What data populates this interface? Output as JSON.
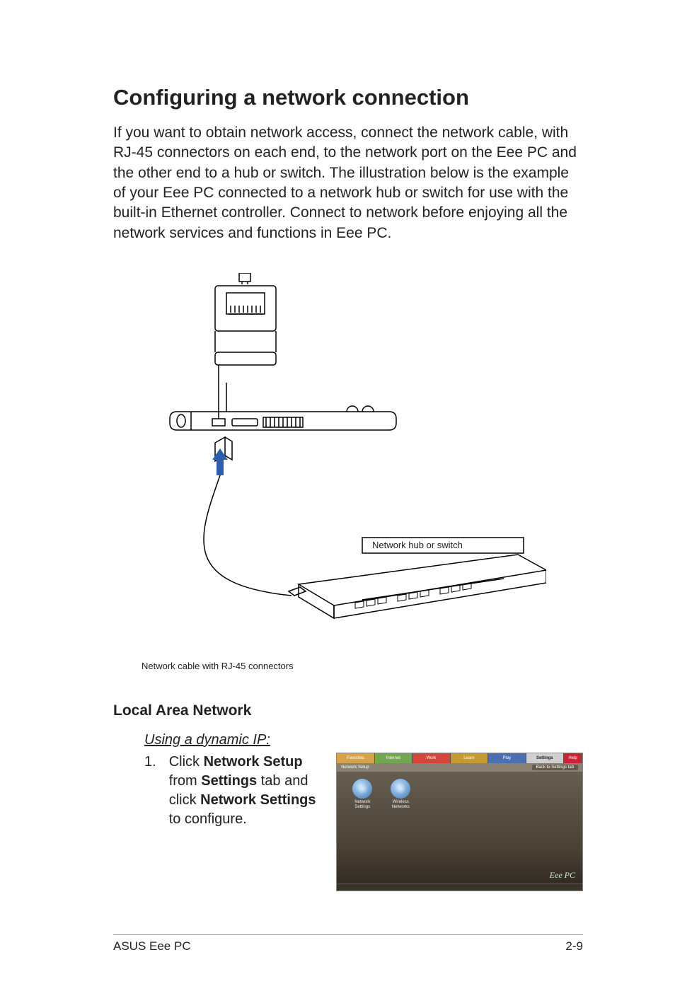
{
  "h1": "Configuring a network connection",
  "intro": "If you want to obtain network access, connect the network cable, with RJ-45 connectors on each end, to the network port on the Eee PC and the other end to a hub or switch. The illustration below is the example of your Eee PC connected to a network hub or switch for use with the built-in Ethernet controller. Connect to network before enjoying all the network services and functions in Eee PC.",
  "figure": {
    "hub_label": "Network hub or switch",
    "cable_label": "Network cable with RJ-45 connectors"
  },
  "h2": "Local Area Network",
  "h3": "Using a dynamic IP:",
  "step1": {
    "num": "1.",
    "pre": "Click ",
    "b1": "Network Setup",
    "mid1": " from ",
    "b2": "Settings",
    "mid2": " tab and click ",
    "b3": "Network Settings",
    "post": " to configure."
  },
  "screenshot": {
    "tabs": {
      "favorites": "Favorites",
      "internet": "Internet",
      "work": "Work",
      "learn": "Learn",
      "play": "Play",
      "settings": "Settings",
      "help": "Help"
    },
    "subtitle": "Network Setup",
    "back": "Back to Settings tab",
    "icon1_l1": "Network",
    "icon1_l2": "Settings",
    "icon2_l1": "Wireless",
    "icon2_l2": "Networks",
    "logo": "Eee PC"
  },
  "footer": {
    "left": "ASUS Eee PC",
    "right": "2-9"
  }
}
